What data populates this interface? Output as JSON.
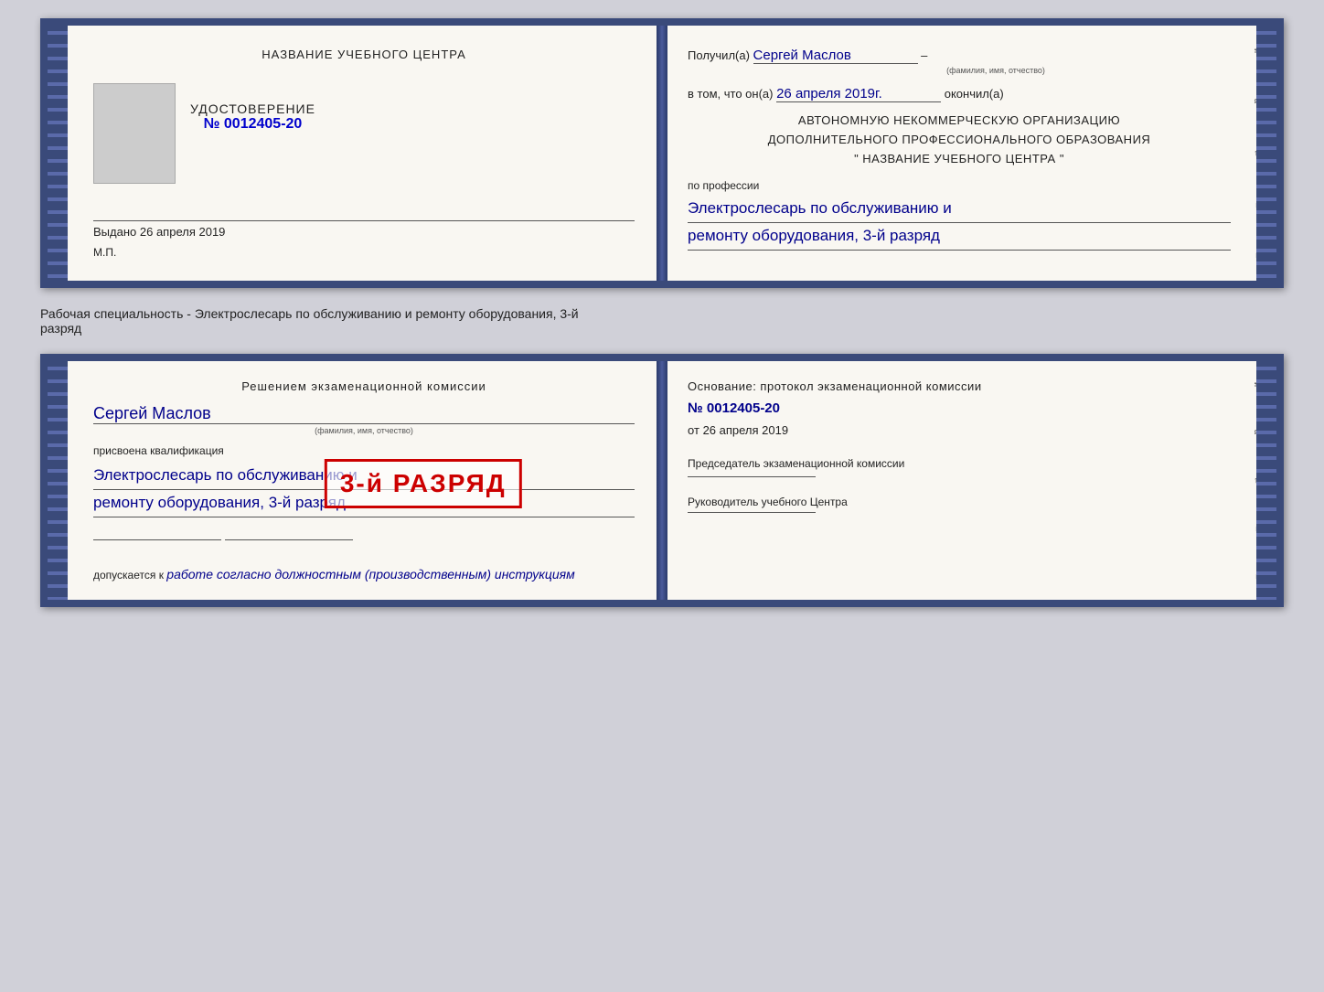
{
  "top_book": {
    "left": {
      "page_title": "НАЗВАНИЕ УЧЕБНОГО ЦЕНТРА",
      "udostoverenie_label": "УДОСТОВЕРЕНИЕ",
      "number": "№ 0012405-20",
      "issued_label": "Выдано",
      "issued_date": "26 апреля 2019",
      "stamp_mp": "М.П."
    },
    "right": {
      "poluchil_label": "Получил(а)",
      "recipient_name": "Сергей Маслов",
      "fio_label": "(фамилия, имя, отчество)",
      "vtom_label": "в том, что он(а)",
      "date_value": "26 апреля 2019г.",
      "okonchil_label": "окончил(а)",
      "org_line1": "АВТОНОМНУЮ НЕКОММЕРЧЕСКУЮ ОРГАНИЗАЦИЮ",
      "org_line2": "ДОПОЛНИТЕЛЬНОГО ПРОФЕССИОНАЛЬНОГО ОБРАЗОВАНИЯ",
      "org_line3": "\"  НАЗВАНИЕ УЧЕБНОГО ЦЕНТРА  \"",
      "po_professii": "по профессии",
      "profession_line1": "Электрослесарь по обслуживанию и",
      "profession_line2": "ремонту оборудования, 3-й разряд",
      "right_markers": [
        "и",
        "а",
        "←",
        "–",
        "–",
        "–"
      ]
    }
  },
  "description": {
    "text": "Рабочая специальность - Электрослесарь по обслуживанию и ремонту оборудования, 3-й",
    "text2": "разряд"
  },
  "bottom_book": {
    "left": {
      "resheniem_label": "Решением экзаменационной комиссии",
      "name": "Сергей Маслов",
      "fio_label": "(фамилия, имя, отчество)",
      "prisvoena_label": "присвоена квалификация",
      "qual_line1": "Электрослесарь по обслуживанию и",
      "qual_line2": "ремонту оборудования, 3-й разряд",
      "допускается_label": "допускается к",
      "допускается_value": "работе согласно должностным (производственным) инструкциям"
    },
    "stamp": {
      "text": "3-й РАЗРЯД"
    },
    "right": {
      "osnov_text": "Основание: протокол экзаменационной комиссии",
      "number": "№  0012405-20",
      "ot_label": "от",
      "ot_date": "26 апреля 2019",
      "predsedatel_label": "Председатель экзаменационной комиссии",
      "ruk_label": "Руководитель учебного Центра",
      "right_markers": [
        "и",
        "а",
        "←",
        "–",
        "–",
        "–"
      ]
    }
  }
}
